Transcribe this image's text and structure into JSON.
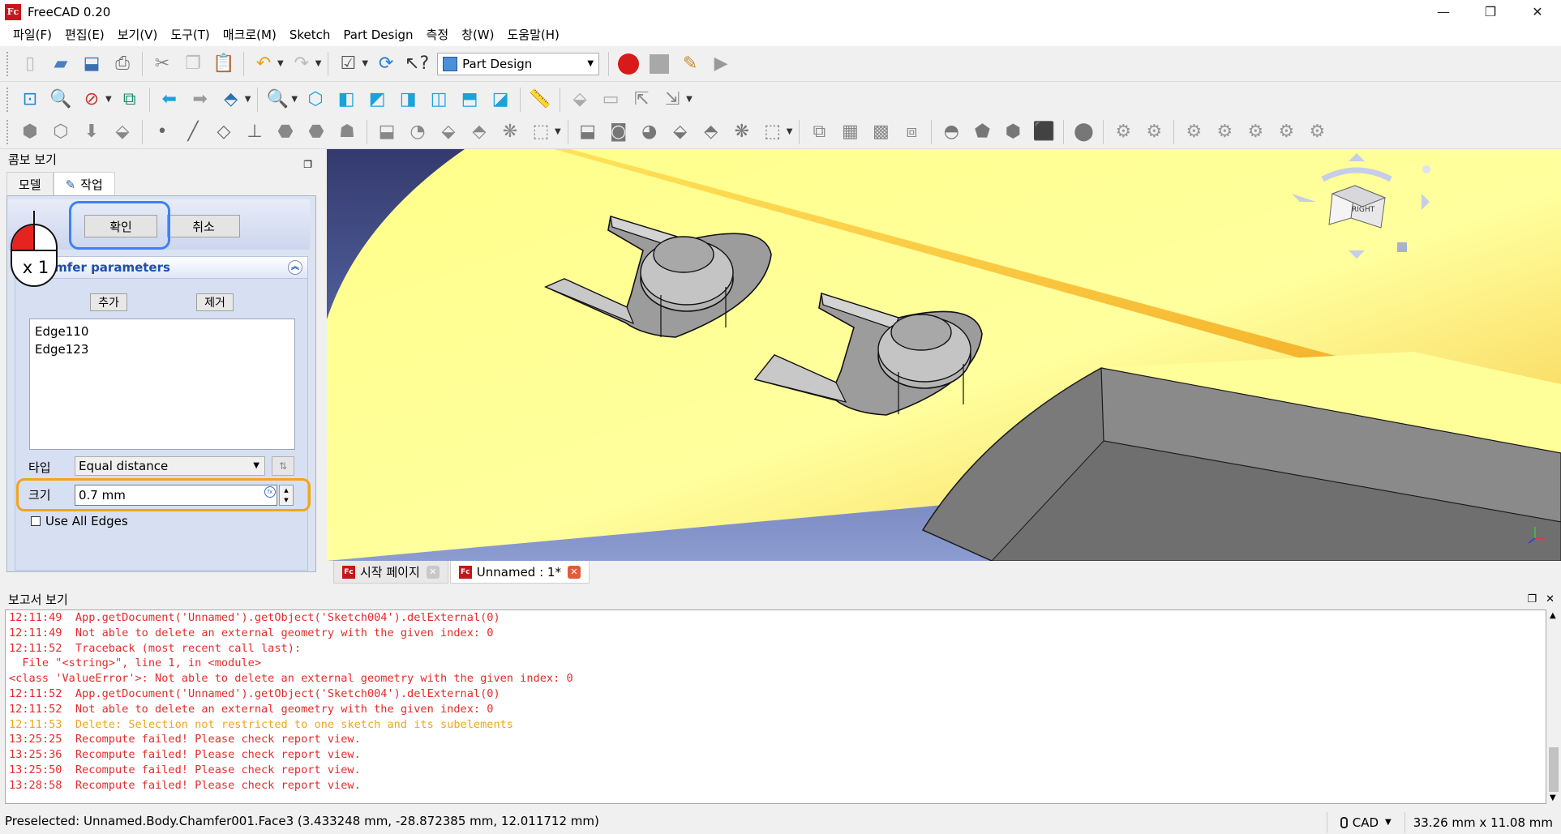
{
  "window": {
    "title": "FreeCAD 0.20",
    "logo_text": "Fc",
    "minimize": "—",
    "restore": "❐",
    "close": "✕"
  },
  "menu": [
    "파일(F)",
    "편집(E)",
    "보기(V)",
    "도구(T)",
    "매크로(M)",
    "Sketch",
    "Part Design",
    "측정",
    "창(W)",
    "도움말(H)"
  ],
  "toolbar": {
    "workbench": "Part Design"
  },
  "combo": {
    "title": "콤보 보기",
    "tabs": {
      "model": "모델",
      "task": "작업"
    },
    "ok": "확인",
    "cancel": "취소",
    "panel_title": "amfer parameters",
    "add": "추가",
    "remove": "제거",
    "edges": [
      "Edge110",
      "Edge123"
    ],
    "type_label": "타입",
    "type_value": "Equal distance",
    "size_label": "크기",
    "size_value": "0.7 mm",
    "use_all_edges": "Use All Edges"
  },
  "annotation": {
    "click_count": "x 1"
  },
  "view": {
    "tabs": [
      {
        "label": "시작 페이지"
      },
      {
        "label": "Unnamed : 1*"
      }
    ],
    "navcube_face": "RIGHT",
    "background_top": "#343a6e",
    "surface_color": "#ffff80"
  },
  "report": {
    "title": "보고서 보기",
    "lines": [
      {
        "text": "12:11:49  App.getDocument('Unnamed').getObject('Sketch004').delExternal(0)",
        "kind": "error"
      },
      {
        "text": "12:11:49  Not able to delete an external geometry with the given index: 0",
        "kind": "error"
      },
      {
        "text": "12:11:52  Traceback (most recent call last):",
        "kind": "error"
      },
      {
        "text": "  File \"<string>\", line 1, in <module>",
        "kind": "error"
      },
      {
        "text": "<class 'ValueError'>: Not able to delete an external geometry with the given index: 0",
        "kind": "error"
      },
      {
        "text": "12:11:52  App.getDocument('Unnamed').getObject('Sketch004').delExternal(0)",
        "kind": "error"
      },
      {
        "text": "12:11:52  Not able to delete an external geometry with the given index: 0",
        "kind": "error"
      },
      {
        "text": "12:11:53  Delete: Selection not restricted to one sketch and its subelements",
        "kind": "warn"
      },
      {
        "text": "13:25:25  Recompute failed! Please check report view.",
        "kind": "error"
      },
      {
        "text": "13:25:36  Recompute failed! Please check report view.",
        "kind": "error"
      },
      {
        "text": "13:25:50  Recompute failed! Please check report view.",
        "kind": "error"
      },
      {
        "text": "13:28:58  Recompute failed! Please check report view.",
        "kind": "error"
      }
    ]
  },
  "status": {
    "message": "Preselected: Unnamed.Body.Chamfer001.Face3 (3.433248 mm, -28.872385 mm, 12.011712 mm)",
    "nav_style": "CAD",
    "dimensions": "33.26 mm x 11.08 mm"
  }
}
